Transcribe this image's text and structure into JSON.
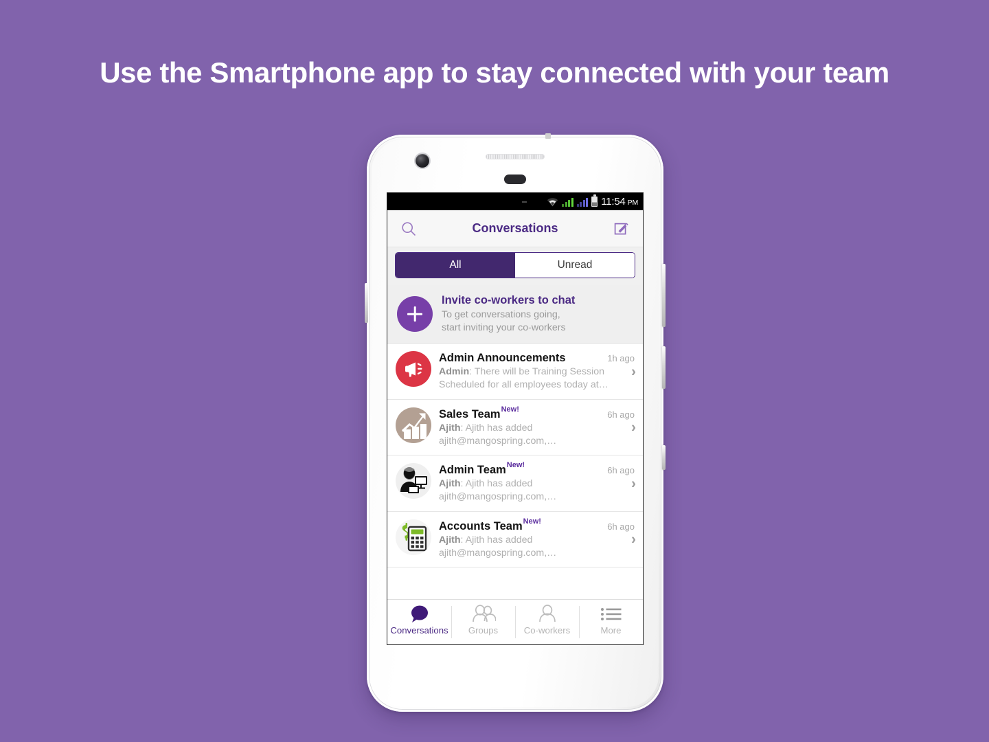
{
  "page": {
    "headline": "Use the Smartphone app to stay connected with your team",
    "background_color": "#8163AC",
    "accent_color": "#4B2A84"
  },
  "status_bar": {
    "time": "11:54",
    "ampm": "PM",
    "icons": [
      "wifi-icon",
      "signal-icon",
      "signal-icon",
      "battery-icon"
    ]
  },
  "header": {
    "title": "Conversations",
    "search_icon": "search-icon",
    "compose_icon": "compose-icon"
  },
  "segments": [
    {
      "label": "All",
      "active": true
    },
    {
      "label": "Unread",
      "active": false
    }
  ],
  "invite": {
    "title": "Invite co-workers to chat",
    "subtitle_line1": "To get conversations going,",
    "subtitle_line2": "start inviting your co-workers",
    "plus_icon": "plus-icon",
    "chevron": "›"
  },
  "conversations": [
    {
      "name": "Admin Announcements",
      "badge": "",
      "time": "1h ago",
      "sender": "Admin",
      "snippet": ": There will be Training Session Scheduled for all employees today at…",
      "avatar": "megaphone-icon",
      "avatar_color": "#DC3545",
      "chevron": "›"
    },
    {
      "name": "Sales Team",
      "badge": "New!",
      "time": "6h ago",
      "sender": "Ajith",
      "snippet": ": Ajith has added ajith@mangospring.com,…",
      "avatar": "growth-chart-icon",
      "avatar_color": "#B3A093",
      "chevron": "›"
    },
    {
      "name": "Admin Team",
      "badge": "New!",
      "time": "6h ago",
      "sender": "Ajith",
      "snippet": ": Ajith has added ajith@mangospring.com,…",
      "avatar": "admin-user-icon",
      "avatar_color": "#EFEFEF",
      "chevron": "›"
    },
    {
      "name": "Accounts Team",
      "badge": "New!",
      "time": "6h ago",
      "sender": "Ajith",
      "snippet": ": Ajith has added ajith@mangospring.com,…",
      "avatar": "calculator-icon",
      "avatar_color": "#F4F4F4",
      "chevron": "›"
    }
  ],
  "tabs": [
    {
      "label": "Conversations",
      "icon": "speech-bubble-icon",
      "active": true
    },
    {
      "label": "Groups",
      "icon": "group-people-icon",
      "active": false
    },
    {
      "label": "Co-workers",
      "icon": "person-icon",
      "active": false
    },
    {
      "label": "More",
      "icon": "list-menu-icon",
      "active": false
    }
  ]
}
